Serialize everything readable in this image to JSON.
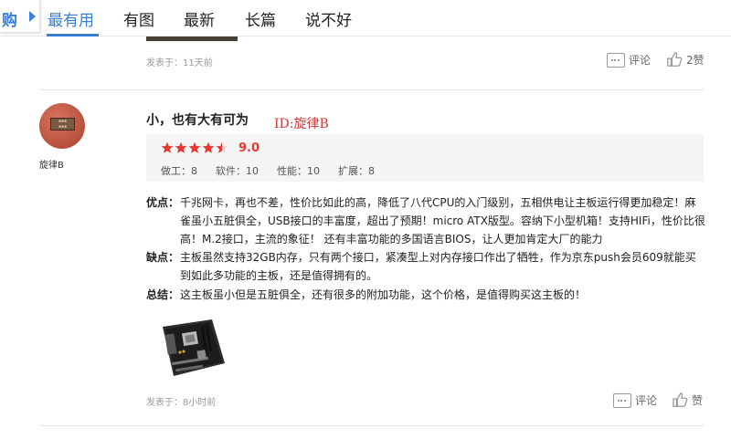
{
  "nav": {
    "side_tab_label": "购",
    "tabs": [
      {
        "label": "最有用",
        "active": true
      },
      {
        "label": "有图",
        "active": false
      },
      {
        "label": "最新",
        "active": false
      },
      {
        "label": "长篇",
        "active": false
      },
      {
        "label": "说不好",
        "active": false
      }
    ],
    "accent_color": "#3b7fd4"
  },
  "prev_review": {
    "date": "发表于：11天前",
    "comment_label": "评论",
    "like_label": "2赞"
  },
  "review": {
    "username": "旋律B",
    "title": "小，也有大有可为",
    "watermark": "ID:旋律B",
    "rating": {
      "stars": 4.5,
      "max_stars": 5,
      "score": "9.0",
      "subscores": [
        {
          "label": "做工：8"
        },
        {
          "label": "软件：10"
        },
        {
          "label": "性能：10"
        },
        {
          "label": "扩展：8"
        }
      ]
    },
    "pros_label": "优点：",
    "pros": "千兆网卡，再也不差，性价比如此的高，降低了八代CPU的入门级别，五相供电让主板运行得更加稳定！麻雀虽小五脏俱全，USB接口的丰富度，超出了预期！micro ATX版型。容纳下小型机箱！支持HIFi，性价比很高！M.2接口，主流的象征！ 还有丰富功能的多国语言BIOS，让人更加肯定大厂的能力",
    "cons_label": "缺点：",
    "cons": "主板虽然支持32GB内存，只有两个接口，紧凑型上对内存接口作出了牺牲，作为京东push会员609就能买到如此多功能的主板，还是值得拥有的。",
    "summary_label": "总结：",
    "summary": "这主板虽小但是五脏俱全，还有很多的附加功能，这个价格，是值得购买这主板的！",
    "date": "发表于：8小时前",
    "comment_label": "评论",
    "like_label": "赞",
    "star_color": "#e53935"
  }
}
